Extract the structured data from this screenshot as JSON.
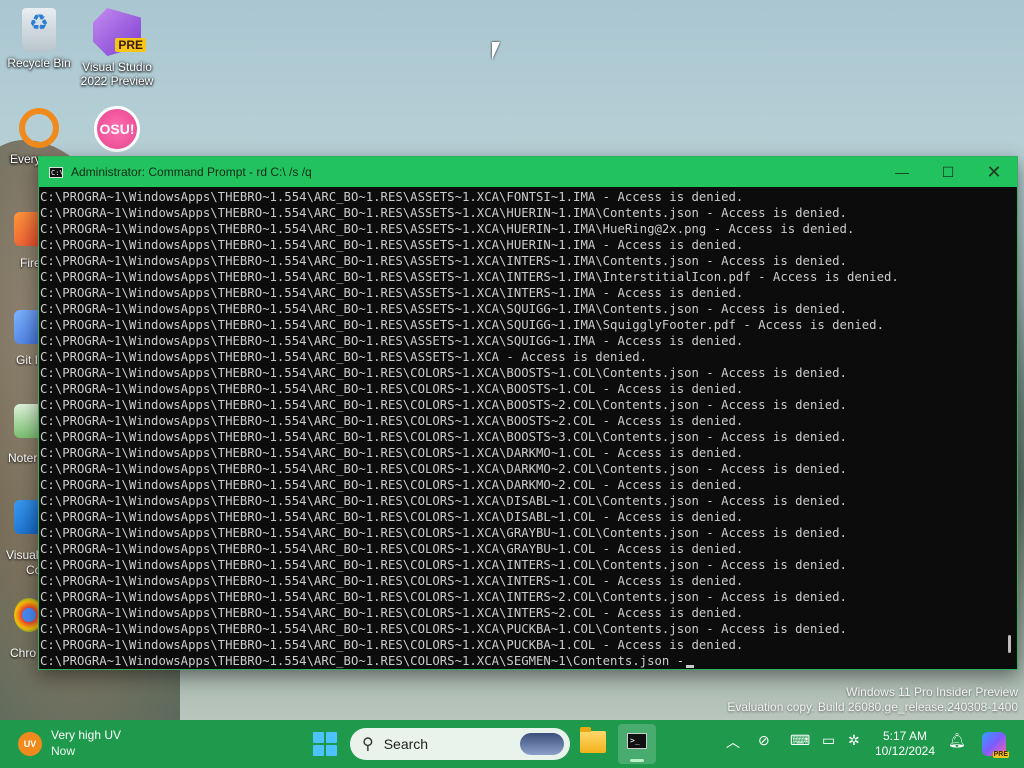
{
  "desktop": {
    "icons": [
      {
        "label": "Recycle Bin"
      },
      {
        "label": "Visual Studio 2022 Preview",
        "badge": "PRE"
      },
      {
        "label": "Every"
      },
      {
        "label": "",
        "badge": "OSU!"
      }
    ],
    "side_labels": [
      "Fire",
      "Git I",
      "Noter",
      "Visual",
      "Co",
      "Chro"
    ]
  },
  "cmd_window": {
    "title": "Administrator: Command Prompt - rd  C:\\ /s /q",
    "title_color": "#22c35e",
    "lines": [
      "C:\\PROGRA~1\\WindowsApps\\THEBRO~1.554\\ARC_BO~1.RES\\ASSETS~1.XCA\\FONTSI~1.IMA - Access is denied.",
      "C:\\PROGRA~1\\WindowsApps\\THEBRO~1.554\\ARC_BO~1.RES\\ASSETS~1.XCA\\HUERIN~1.IMA\\Contents.json - Access is denied.",
      "C:\\PROGRA~1\\WindowsApps\\THEBRO~1.554\\ARC_BO~1.RES\\ASSETS~1.XCA\\HUERIN~1.IMA\\HueRing@2x.png - Access is denied.",
      "C:\\PROGRA~1\\WindowsApps\\THEBRO~1.554\\ARC_BO~1.RES\\ASSETS~1.XCA\\HUERIN~1.IMA - Access is denied.",
      "C:\\PROGRA~1\\WindowsApps\\THEBRO~1.554\\ARC_BO~1.RES\\ASSETS~1.XCA\\INTERS~1.IMA\\Contents.json - Access is denied.",
      "C:\\PROGRA~1\\WindowsApps\\THEBRO~1.554\\ARC_BO~1.RES\\ASSETS~1.XCA\\INTERS~1.IMA\\InterstitialIcon.pdf - Access is denied.",
      "C:\\PROGRA~1\\WindowsApps\\THEBRO~1.554\\ARC_BO~1.RES\\ASSETS~1.XCA\\INTERS~1.IMA - Access is denied.",
      "C:\\PROGRA~1\\WindowsApps\\THEBRO~1.554\\ARC_BO~1.RES\\ASSETS~1.XCA\\SQUIGG~1.IMA\\Contents.json - Access is denied.",
      "C:\\PROGRA~1\\WindowsApps\\THEBRO~1.554\\ARC_BO~1.RES\\ASSETS~1.XCA\\SQUIGG~1.IMA\\SquigglyFooter.pdf - Access is denied.",
      "C:\\PROGRA~1\\WindowsApps\\THEBRO~1.554\\ARC_BO~1.RES\\ASSETS~1.XCA\\SQUIGG~1.IMA - Access is denied.",
      "C:\\PROGRA~1\\WindowsApps\\THEBRO~1.554\\ARC_BO~1.RES\\ASSETS~1.XCA - Access is denied.",
      "C:\\PROGRA~1\\WindowsApps\\THEBRO~1.554\\ARC_BO~1.RES\\COLORS~1.XCA\\BOOSTS~1.COL\\Contents.json - Access is denied.",
      "C:\\PROGRA~1\\WindowsApps\\THEBRO~1.554\\ARC_BO~1.RES\\COLORS~1.XCA\\BOOSTS~1.COL - Access is denied.",
      "C:\\PROGRA~1\\WindowsApps\\THEBRO~1.554\\ARC_BO~1.RES\\COLORS~1.XCA\\BOOSTS~2.COL\\Contents.json - Access is denied.",
      "C:\\PROGRA~1\\WindowsApps\\THEBRO~1.554\\ARC_BO~1.RES\\COLORS~1.XCA\\BOOSTS~2.COL - Access is denied.",
      "C:\\PROGRA~1\\WindowsApps\\THEBRO~1.554\\ARC_BO~1.RES\\COLORS~1.XCA\\BOOSTS~3.COL\\Contents.json - Access is denied.",
      "C:\\PROGRA~1\\WindowsApps\\THEBRO~1.554\\ARC_BO~1.RES\\COLORS~1.XCA\\DARKMO~1.COL - Access is denied.",
      "C:\\PROGRA~1\\WindowsApps\\THEBRO~1.554\\ARC_BO~1.RES\\COLORS~1.XCA\\DARKMO~2.COL\\Contents.json - Access is denied.",
      "C:\\PROGRA~1\\WindowsApps\\THEBRO~1.554\\ARC_BO~1.RES\\COLORS~1.XCA\\DARKMO~2.COL - Access is denied.",
      "C:\\PROGRA~1\\WindowsApps\\THEBRO~1.554\\ARC_BO~1.RES\\COLORS~1.XCA\\DISABL~1.COL\\Contents.json - Access is denied.",
      "C:\\PROGRA~1\\WindowsApps\\THEBRO~1.554\\ARC_BO~1.RES\\COLORS~1.XCA\\DISABL~1.COL - Access is denied.",
      "C:\\PROGRA~1\\WindowsApps\\THEBRO~1.554\\ARC_BO~1.RES\\COLORS~1.XCA\\GRAYBU~1.COL\\Contents.json - Access is denied.",
      "C:\\PROGRA~1\\WindowsApps\\THEBRO~1.554\\ARC_BO~1.RES\\COLORS~1.XCA\\GRAYBU~1.COL - Access is denied.",
      "C:\\PROGRA~1\\WindowsApps\\THEBRO~1.554\\ARC_BO~1.RES\\COLORS~1.XCA\\INTERS~1.COL\\Contents.json - Access is denied.",
      "C:\\PROGRA~1\\WindowsApps\\THEBRO~1.554\\ARC_BO~1.RES\\COLORS~1.XCA\\INTERS~1.COL - Access is denied.",
      "C:\\PROGRA~1\\WindowsApps\\THEBRO~1.554\\ARC_BO~1.RES\\COLORS~1.XCA\\INTERS~2.COL\\Contents.json - Access is denied.",
      "C:\\PROGRA~1\\WindowsApps\\THEBRO~1.554\\ARC_BO~1.RES\\COLORS~1.XCA\\INTERS~2.COL - Access is denied.",
      "C:\\PROGRA~1\\WindowsApps\\THEBRO~1.554\\ARC_BO~1.RES\\COLORS~1.XCA\\PUCKBA~1.COL\\Contents.json - Access is denied.",
      "C:\\PROGRA~1\\WindowsApps\\THEBRO~1.554\\ARC_BO~1.RES\\COLORS~1.XCA\\PUCKBA~1.COL - Access is denied.",
      "C:\\PROGRA~1\\WindowsApps\\THEBRO~1.554\\ARC_BO~1.RES\\COLORS~1.XCA\\SEGMEN~1\\Contents.json -"
    ]
  },
  "watermark": {
    "line1": "Windows 11 Pro Insider Preview",
    "line2": "Evaluation copy. Build 26080.ge_release.240308-1400"
  },
  "taskbar": {
    "accent": "#1f9a4d",
    "weather_icon": "UV",
    "weather_title": "Very high UV",
    "weather_sub": "Now",
    "search_label": "Search",
    "time": "5:17 AM",
    "date": "10/12/2024",
    "copilot_badge": "PRE",
    "tray_icons": [
      "chevron-up-icon",
      "network-off-icon",
      "keyboard-icon",
      "display-icon",
      "accessibility-icon",
      "bell-icon"
    ]
  }
}
